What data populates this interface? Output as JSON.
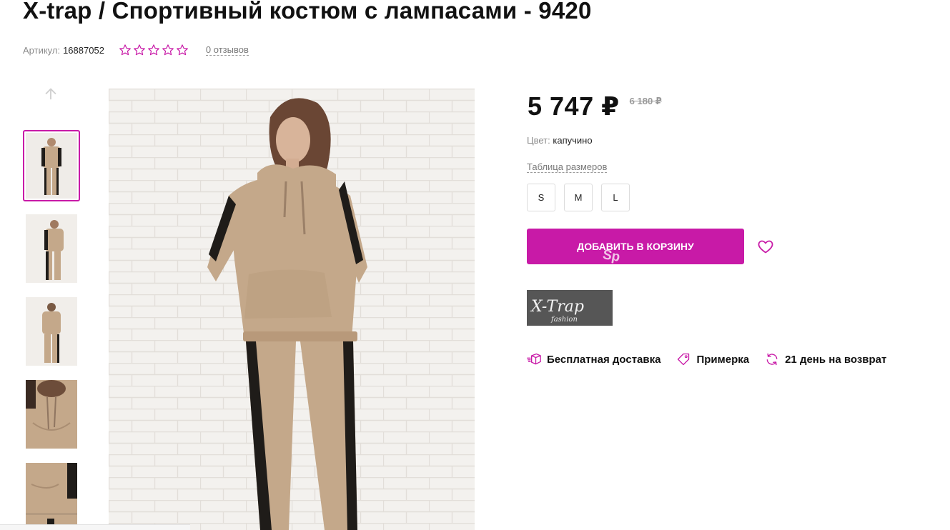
{
  "product": {
    "title": "X-trap / Спортивный костюм с лампасами - 9420",
    "article_label": "Артикул:",
    "article": "16887052",
    "rating_stars": 5,
    "reviews": "0 отзывов"
  },
  "pricing": {
    "price": "5 747 ₽",
    "old_price": "6 180 ₽"
  },
  "color": {
    "label": "Цвет:",
    "value": "капучино"
  },
  "size_table_link": "Таблица размеров",
  "sizes": [
    "S",
    "M",
    "L"
  ],
  "cart": {
    "button_label": "ДОБАВИТЬ В КОРЗИНУ",
    "overlay_text": "Sp"
  },
  "brand": {
    "logo_text": "X-Trap",
    "logo_subtext": "fashion"
  },
  "features": [
    {
      "icon": "delivery-box-icon",
      "label": "Бесплатная доставка"
    },
    {
      "icon": "tag-icon",
      "label": "Примерка"
    },
    {
      "icon": "refresh-icon",
      "label": "21 день на возврат"
    }
  ],
  "colors": {
    "accent": "#c81aa7",
    "suit": "#c4a88a",
    "stripe": "#1f1c19",
    "wall": "#f1eeea"
  }
}
